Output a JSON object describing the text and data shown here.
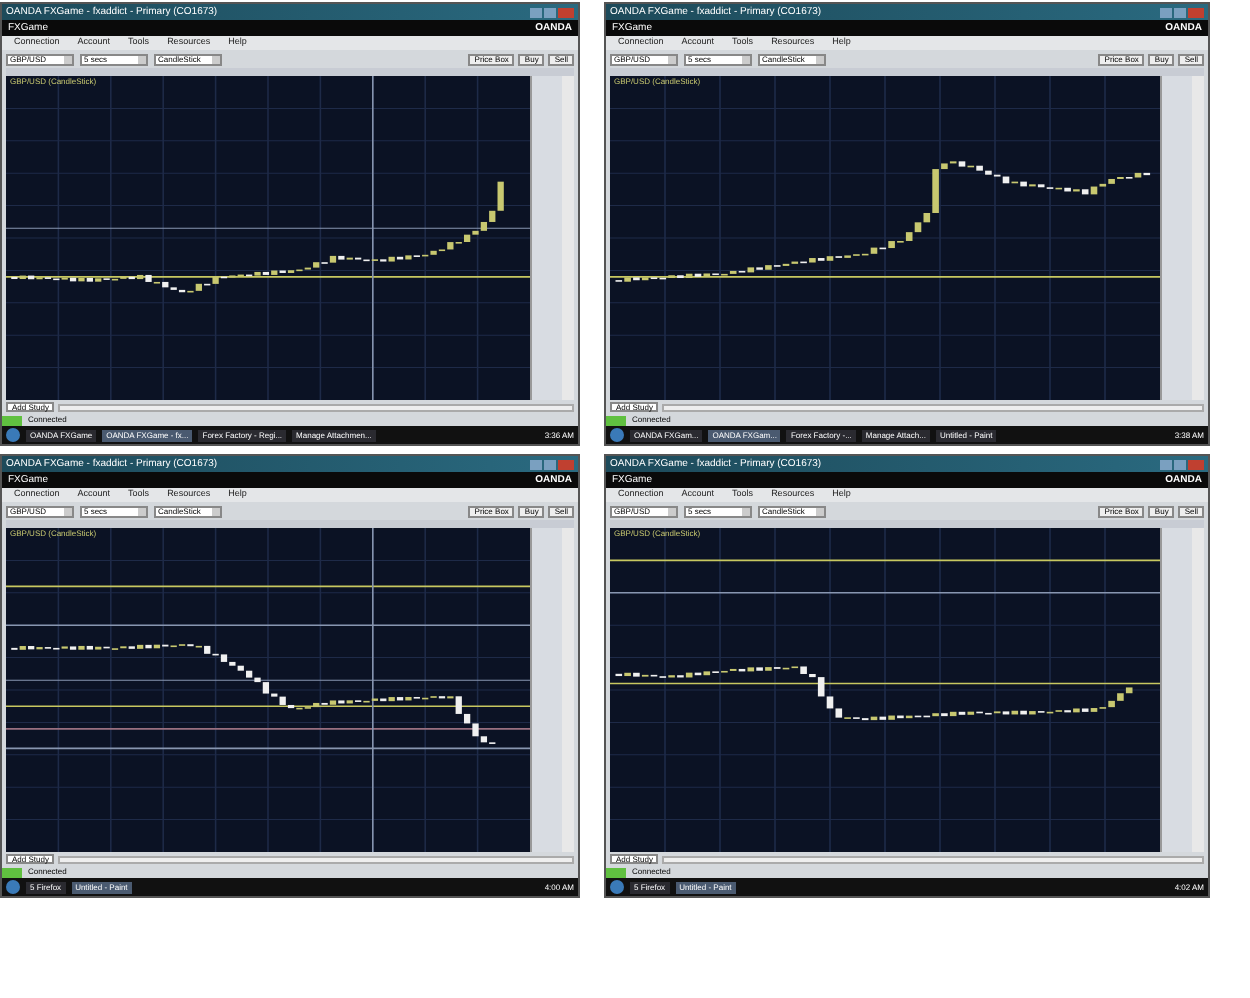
{
  "windows": [
    {
      "title": "OANDA FXGame - fxaddict - Primary (CO1673)",
      "brand": "FXGame",
      "logo": "OANDA",
      "menu": [
        "Connection",
        "Account",
        "Tools",
        "Resources",
        "Help"
      ],
      "selectors": [
        "GBP/USD",
        "5 secs",
        "CandleStick"
      ],
      "buttons": [
        "Price Box",
        "Buy",
        "Sell"
      ],
      "chart_label": "GBP/USD (CandleStick)",
      "study": "Add Study",
      "status": "Connected",
      "taskbar": {
        "items": [
          {
            "label": "OANDA FXGame",
            "selected": false
          },
          {
            "label": "OANDA FXGame - fx...",
            "selected": true
          },
          {
            "label": "Forex Factory - Regi...",
            "selected": false
          },
          {
            "label": "Manage Attachmen...",
            "selected": false
          }
        ],
        "clock": "3:36 AM"
      }
    },
    {
      "title": "OANDA FXGame - fxaddict - Primary (CO1673)",
      "brand": "FXGame",
      "logo": "OANDA",
      "menu": [
        "Connection",
        "Account",
        "Tools",
        "Resources",
        "Help"
      ],
      "selectors": [
        "GBP/USD",
        "5 secs",
        "CandleStick"
      ],
      "buttons": [
        "Price Box",
        "Buy",
        "Sell"
      ],
      "chart_label": "GBP/USD (CandleStick)",
      "study": "Add Study",
      "status": "Connected",
      "taskbar": {
        "items": [
          {
            "label": "OANDA FXGam...",
            "selected": false
          },
          {
            "label": "OANDA FXGam...",
            "selected": true
          },
          {
            "label": "Forex Factory -...",
            "selected": false
          },
          {
            "label": "Manage Attach...",
            "selected": false
          },
          {
            "label": "Untitled - Paint",
            "selected": false
          }
        ],
        "clock": "3:38 AM"
      }
    },
    {
      "title": "OANDA FXGame - fxaddict - Primary (CO1673)",
      "brand": "FXGame",
      "logo": "OANDA",
      "menu": [
        "Connection",
        "Account",
        "Tools",
        "Resources",
        "Help"
      ],
      "selectors": [
        "GBP/USD",
        "5 secs",
        "CandleStick"
      ],
      "buttons": [
        "Price Box",
        "Buy",
        "Sell"
      ],
      "chart_label": "GBP/USD (CandleStick)",
      "study": "Add Study",
      "status": "Connected",
      "taskbar": {
        "items": [
          {
            "label": "5 Firefox",
            "selected": false
          },
          {
            "label": "Untitled - Paint",
            "selected": true
          }
        ],
        "clock": "4:00 AM"
      }
    },
    {
      "title": "OANDA FXGame - fxaddict - Primary (CO1673)",
      "brand": "FXGame",
      "logo": "OANDA",
      "menu": [
        "Connection",
        "Account",
        "Tools",
        "Resources",
        "Help"
      ],
      "selectors": [
        "GBP/USD",
        "5 secs",
        "CandleStick"
      ],
      "buttons": [
        "Price Box",
        "Buy",
        "Sell"
      ],
      "chart_label": "GBP/USD (CandleStick)",
      "study": "Add Study",
      "status": "Connected",
      "taskbar": {
        "items": [
          {
            "label": "5 Firefox",
            "selected": false
          },
          {
            "label": "Untitled - Paint",
            "selected": true
          }
        ],
        "clock": "4:02 AM"
      }
    }
  ]
}
